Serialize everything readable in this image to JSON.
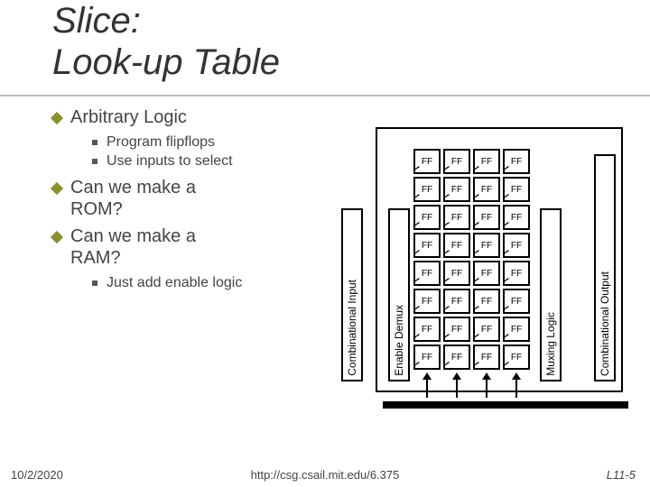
{
  "title_line1": "Slice:",
  "title_line2": "Look-up Table",
  "bullets": {
    "b0": "Arbitrary Logic",
    "b0_sub0": "Program flipflops",
    "b0_sub1": "Use inputs to select",
    "b1_l1": "Can we make a",
    "b1_l2": "ROM?",
    "b2_l1": "Can we make a",
    "b2_l2": "RAM?",
    "b2_sub0": "Just add enable logic"
  },
  "diagram": {
    "combin": "Combinational Input",
    "endemux": "Enable Demux",
    "muxing": "Muxing Logic",
    "combout": "Combinational Output",
    "ff_label": "FF",
    "ff_rows": 8,
    "ff_cols": 4
  },
  "footer": {
    "date": "10/2/2020",
    "url": "http://csg.csail.mit.edu/6.375",
    "page": "L11-5"
  }
}
